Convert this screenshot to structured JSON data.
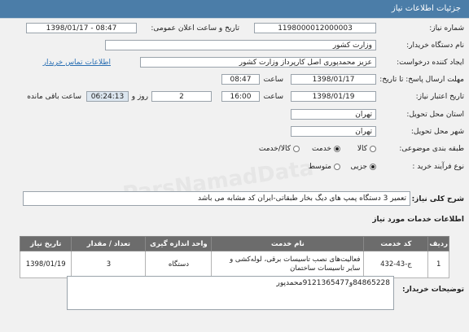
{
  "header": {
    "title": "جزئیات اطلاعات نیاز"
  },
  "fields": {
    "need_number_label": "شماره نیاز:",
    "need_number": "1198000012000003",
    "announce_label": "تاریخ و ساعت اعلان عمومی:",
    "announce_value": "1398/01/17 - 08:47",
    "buyer_label": "نام دستگاه خریدار:",
    "buyer_value": "وزارت کشور",
    "creator_label": "ایجاد کننده درخواست:",
    "creator_value": "عزیز محمدپوری اصل کارپرداز وزارت کشور",
    "contact_link": "اطلاعات تماس خریدار",
    "reply_deadline_label": "مهلت ارسال پاسخ: تا تاریخ:",
    "reply_date": "1398/01/17",
    "time_label": "ساعت",
    "reply_time": "08:47",
    "validity_label": "تاریخ اعتبار نیاز:",
    "validity_date": "1398/01/19",
    "validity_time_label": "ساعت",
    "validity_time": "16:00",
    "days": "2",
    "days_label": "روز و",
    "remaining_time": "06:24:13",
    "remaining_label": "ساعت باقی مانده",
    "province_label": "استان محل تحویل:",
    "province_value": "تهران",
    "city_label": "شهر محل تحویل:",
    "city_value": "تهران",
    "category_label": "طبقه بندی موضوعی:",
    "category_options": [
      "کالا",
      "خدمت",
      "کالا/خدمت"
    ],
    "category_selected": "خدمت",
    "process_label": "نوع فرآیند خرید :",
    "process_options": [
      "جزیی",
      "متوسط"
    ],
    "process_selected": "جزیی",
    "summary_label": "شرح کلی نیاز:",
    "summary_value": "تعمیر 3 دستگاه پمپ های دیگ بخار طبقاتی-ایران کد مشابه می باشد"
  },
  "services": {
    "section_title": "اطلاعات خدمات مورد نیاز",
    "columns": [
      "ردیف",
      "کد خدمت",
      "نام خدمت",
      "واحد اندازه گیری",
      "تعداد / مقدار",
      "تاریخ نیاز"
    ],
    "rows": [
      {
        "index": "1",
        "code": "ج-43-432",
        "name": "فعالیت‌های نصب تاسیسات برقی، لوله‌کشی و سایر تاسیسات ساختمان",
        "unit": "دستگاه",
        "qty": "3",
        "date": "1398/01/19"
      }
    ]
  },
  "buyer_notes": {
    "label": "توضیحات خریدار:",
    "text": "84865228و9121365477محمدپور"
  }
}
